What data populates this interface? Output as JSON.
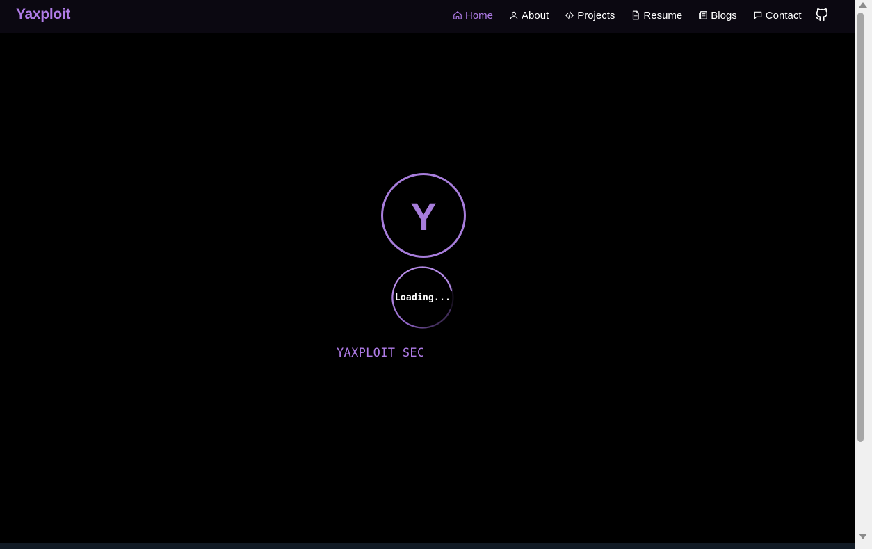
{
  "header": {
    "brand": "Yaxploit",
    "nav": [
      {
        "label": "Home",
        "icon": "home-icon",
        "active": true
      },
      {
        "label": "About",
        "icon": "user-icon",
        "active": false
      },
      {
        "label": "Projects",
        "icon": "code-icon",
        "active": false
      },
      {
        "label": "Resume",
        "icon": "file-icon",
        "active": false
      },
      {
        "label": "Blogs",
        "icon": "newspaper-icon",
        "active": false
      },
      {
        "label": "Contact",
        "icon": "chat-bubble-icon",
        "active": false
      }
    ],
    "github_icon": "github-icon"
  },
  "splash": {
    "logo_letter": "Y",
    "loading_text": "Loading...",
    "typed_text": "YAXPLOIT SEC"
  },
  "colors": {
    "accent": "#b07ce8",
    "ring": "#a77ddb",
    "background": "#000000",
    "navbar": "#0b0811"
  }
}
